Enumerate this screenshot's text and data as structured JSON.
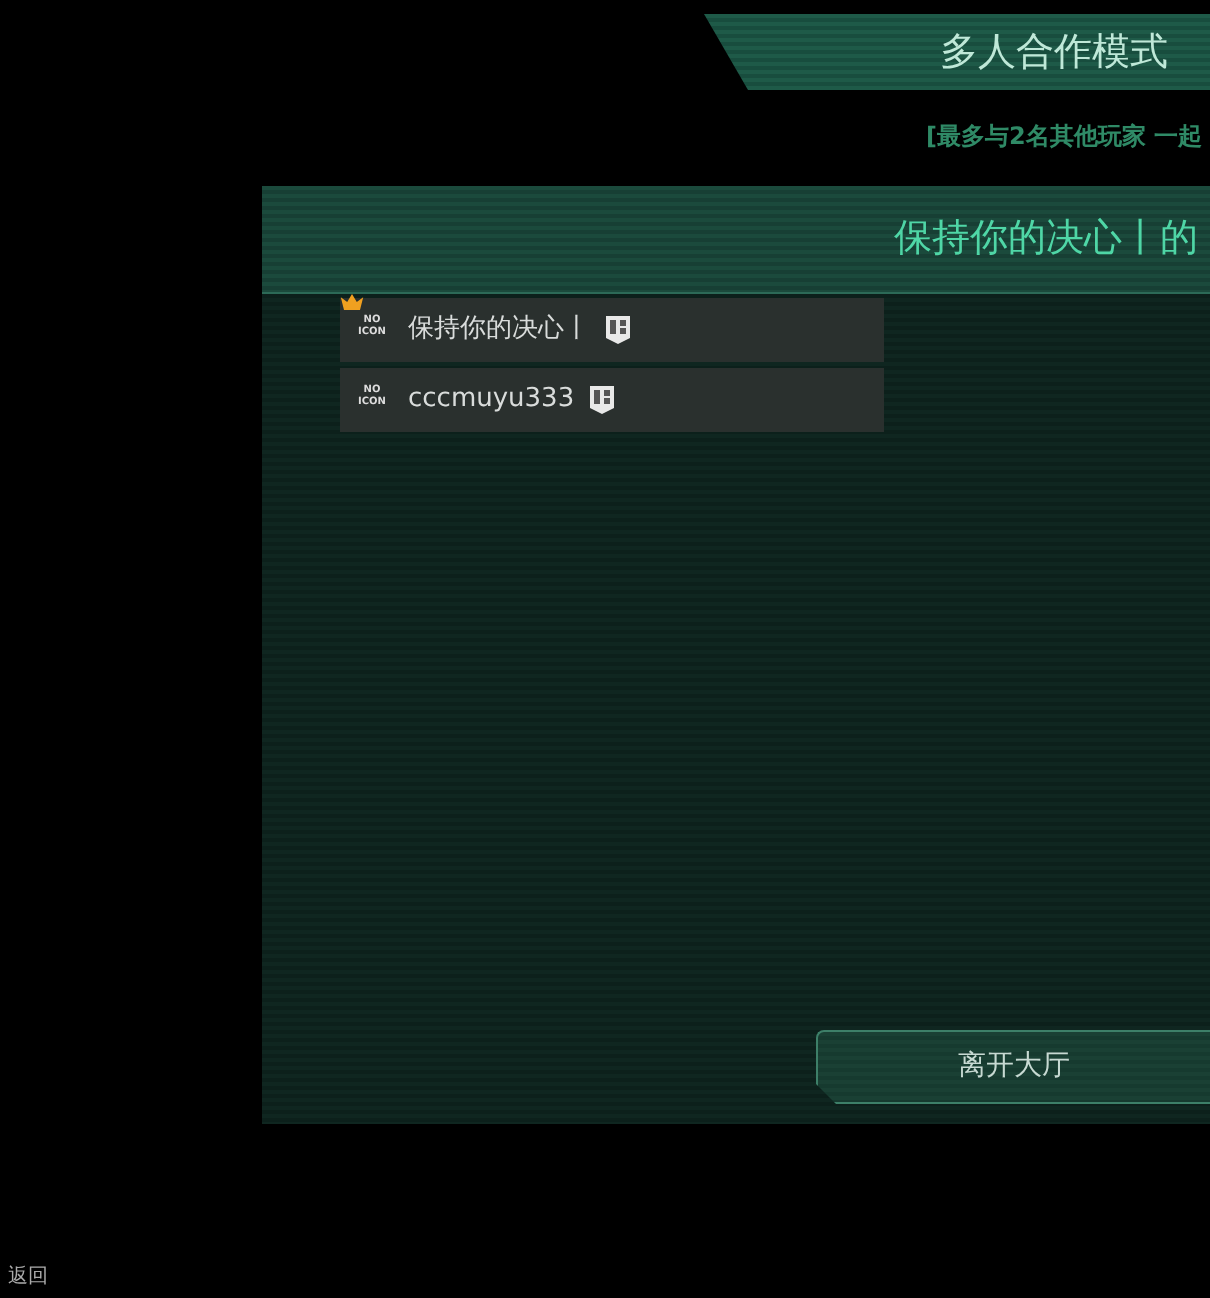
{
  "mode_title": "多人合作模式",
  "subtitle": "[最多与2名其他玩家 一起",
  "lobby_title": "保持你的决心丨的",
  "players": [
    {
      "name": "保持你的决心丨",
      "avatar_text": "NO ICON",
      "host": true
    },
    {
      "name": "cccmuyu333",
      "avatar_text": "NO ICON",
      "host": false
    }
  ],
  "leave_button": "离开大厅",
  "back_label": "返回"
}
